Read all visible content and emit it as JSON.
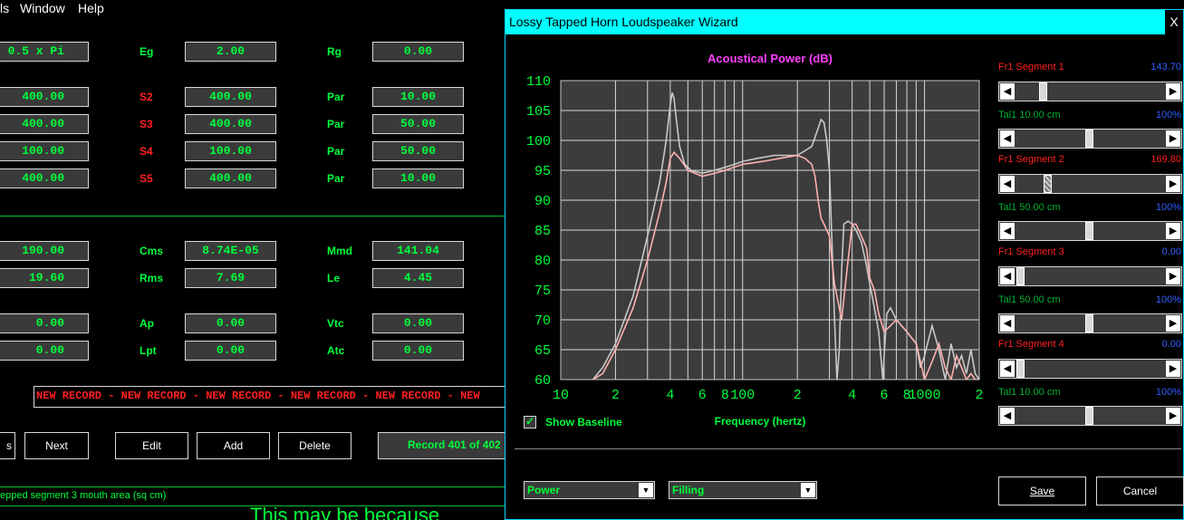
{
  "menu": {
    "item1": "ls",
    "item2": "Window",
    "item3": "Help"
  },
  "main": {
    "rows": [
      {
        "v1": "0.5 x Pi",
        "l2": "Eg",
        "v2": "2.00",
        "l3": "Rg",
        "v3": "0.00"
      },
      {
        "v1": "400.00",
        "l2": "S2",
        "v2": "400.00",
        "l3": "Par",
        "v3": "10.00"
      },
      {
        "v1": "400.00",
        "l2": "S3",
        "v2": "400.00",
        "l3": "Par",
        "v3": "50.00"
      },
      {
        "v1": "100.00",
        "l2": "S4",
        "v2": "100.00",
        "l3": "Par",
        "v3": "50.00"
      },
      {
        "v1": "400.00",
        "l2": "S5",
        "v2": "400.00",
        "l3": "Par",
        "v3": "10.00"
      },
      {
        "v1": "190.00",
        "l2": "Cms",
        "v2": "8.74E-05",
        "l3": "Mmd",
        "v3": "141.04"
      },
      {
        "v1": "19.60",
        "l2": "Rms",
        "v2": "7.69",
        "l3": "Le",
        "v3": "4.45"
      },
      {
        "v1": "0.00",
        "l2": "Ap",
        "v2": "0.00",
        "l3": "Vtc",
        "v3": "0.00"
      },
      {
        "v1": "0.00",
        "l2": "Lpt",
        "v2": "0.00",
        "l3": "Atc",
        "v3": "0.00"
      }
    ],
    "record_banner": "NEW RECORD - NEW RECORD - NEW RECORD - NEW RECORD - NEW RECORD - NEW",
    "buttons": {
      "prev": "s",
      "next": "Next",
      "edit": "Edit",
      "add": "Add",
      "delete": "Delete"
    },
    "record_counter": "Record 401 of 402",
    "status_text": "epped segment 3 mouth area  (sq cm)",
    "overflow_text": "This may be because"
  },
  "wizard": {
    "title": "Lossy Tapped Horn Loudspeaker Wizard",
    "close_glyph": "X",
    "show_baseline_label": "Show Baseline",
    "show_baseline_checked": true,
    "dropdown_power": "Power",
    "dropdown_filling": "Filling",
    "save_label": "Save",
    "cancel_label": "Cancel",
    "segments": [
      {
        "label": "Fr1  Segment 1",
        "value": "143.70",
        "value_color": "#3060ff",
        "thumb": 0.16,
        "tal_label": "Tal1  10.00 cm",
        "tal_value": "100%",
        "tal_thumb": 0.49
      },
      {
        "label": "Fr1  Segment 2",
        "value": "169.80",
        "value_color": "#ff2020",
        "thumb": 0.19,
        "tal_label": "Tal1  50.00 cm",
        "tal_value": "100%",
        "tal_thumb": 0.49
      },
      {
        "label": "Fr1  Segment 3",
        "value": "0.00",
        "value_color": "#3060ff",
        "thumb": 0.0,
        "tal_label": "Tal1  50.00 cm",
        "tal_value": "100%",
        "tal_thumb": 0.49
      },
      {
        "label": "Fr1  Segment 4",
        "value": "0.00",
        "value_color": "#3060ff",
        "thumb": 0.0,
        "tal_label": "Tal1  10.00 cm",
        "tal_value": "100%",
        "tal_thumb": 0.49
      }
    ]
  },
  "chart_data": {
    "type": "line",
    "title": "Acoustical Power (dB)",
    "xlabel": "Frequency (hertz)",
    "ylabel": "",
    "x_scale": "log",
    "xlim": [
      10,
      2000
    ],
    "ylim": [
      60,
      110
    ],
    "yticks": [
      60,
      65,
      70,
      75,
      80,
      85,
      90,
      95,
      100,
      105,
      110
    ],
    "xticks": [
      10,
      20,
      40,
      60,
      80,
      100,
      200,
      400,
      600,
      800,
      1000,
      2000
    ],
    "xtick_labels": [
      "10",
      "2",
      "4",
      "6",
      "8",
      "100",
      "2",
      "4",
      "6",
      "8",
      "1000",
      "2"
    ],
    "grid": true,
    "series": [
      {
        "color": "#c8c8c8",
        "x": [
          15,
          17,
          20,
          25,
          30,
          35,
          38,
          40,
          41,
          42,
          43,
          45,
          48,
          52,
          60,
          70,
          80,
          90,
          100,
          120,
          150,
          200,
          240,
          260,
          270,
          280,
          290,
          300,
          310,
          320,
          330,
          340,
          350,
          360,
          380,
          400,
          420,
          450,
          480,
          500,
          530,
          560,
          590,
          600,
          620,
          650,
          700,
          800,
          900,
          950,
          1000,
          1100,
          1200,
          1300,
          1400,
          1500,
          1600,
          1700,
          1800,
          1900,
          2000
        ],
        "y": [
          60,
          62,
          66,
          74,
          84,
          93,
          100,
          106,
          108,
          107,
          104,
          99,
          96,
          95,
          94.5,
          95,
          95.5,
          96,
          96.5,
          97,
          97.5,
          97.5,
          99,
          102,
          103.5,
          103,
          100,
          95,
          83,
          70,
          60,
          65,
          78,
          86,
          86.5,
          86,
          85,
          83,
          79,
          76,
          72,
          68,
          60,
          64,
          71,
          72,
          70,
          68,
          66,
          62,
          64,
          69,
          65,
          60,
          66,
          62,
          64,
          61,
          65,
          61,
          60
        ]
      },
      {
        "color": "#ffb0b0",
        "x": [
          15,
          17,
          20,
          25,
          30,
          35,
          38,
          40,
          42,
          45,
          50,
          60,
          70,
          80,
          100,
          130,
          160,
          200,
          220,
          240,
          250,
          260,
          270,
          280,
          290,
          300,
          320,
          350,
          380,
          400,
          420,
          450,
          480,
          500,
          530,
          560,
          600,
          650,
          700,
          800,
          900,
          950,
          1000,
          1100,
          1200,
          1300,
          1400,
          1500,
          1600,
          1700,
          1800,
          1900,
          2000
        ],
        "y": [
          60,
          61,
          65,
          72,
          80,
          88,
          93,
          97,
          98,
          97,
          95,
          94,
          94.5,
          95,
          96,
          96.5,
          97,
          97.5,
          97,
          96,
          94,
          90,
          87,
          86,
          85,
          84,
          76,
          70,
          80,
          86,
          86,
          84,
          82,
          77,
          75,
          71,
          68,
          69,
          70,
          68,
          66,
          63,
          60,
          63,
          66,
          62,
          60,
          64,
          62,
          60,
          61,
          60,
          60
        ]
      }
    ]
  }
}
